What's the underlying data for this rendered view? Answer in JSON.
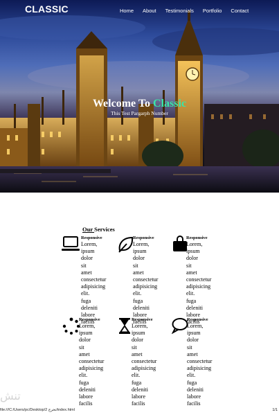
{
  "brand": "CLASSIC",
  "nav": [
    "Home",
    "About",
    "Testimonials",
    "Portfolio",
    "Contact"
  ],
  "hero": {
    "title_prefix": "Welcome To ",
    "title_accent": "Classic",
    "subtitle": "This Test Pargarph Number",
    "accent_color": "#39e6a8"
  },
  "services": {
    "title_underlined": "Our ",
    "title_rest": "Services",
    "items": [
      {
        "icon": "laptop-icon",
        "heading": "Responsive",
        "body": "Lorem, ipsum dolor sit amet consectetur adipisicing elit. fuga deleniti labore facilis"
      },
      {
        "icon": "leaf-icon",
        "heading": "Responsive",
        "body": "Lorem, ipsum dolor sit amet consectetur adipisicing elit. fuga deleniti labore facilis"
      },
      {
        "icon": "shopping-bag-icon",
        "heading": "Responsive",
        "body": "Lorem, ipsum dolor sit amet consectetur adipisicing elit. fuga deleniti labore facilis"
      },
      {
        "icon": "spinner-icon",
        "heading": "Responsive",
        "body": "Lorem, ipsum dolor sit amet consectetur adipisicing elit. fuga deleniti labore facilis"
      },
      {
        "icon": "hourglass-icon",
        "heading": "Responsive",
        "body": "Lorem, ipsum dolor sit amet consectetur adipisicing elit. fuga deleniti labore facilis"
      },
      {
        "icon": "chat-bubble-icon",
        "heading": "Responsive",
        "body": "Lorem, ipsum dolor sit amet consectetur adipisicing elit. fuga deleniti labore facilis"
      }
    ]
  },
  "footer": {
    "path": "file:///C:/Users/pc/Desktop/2 تخرج/index.html",
    "page": "1/1",
    "watermark": "تنش"
  }
}
